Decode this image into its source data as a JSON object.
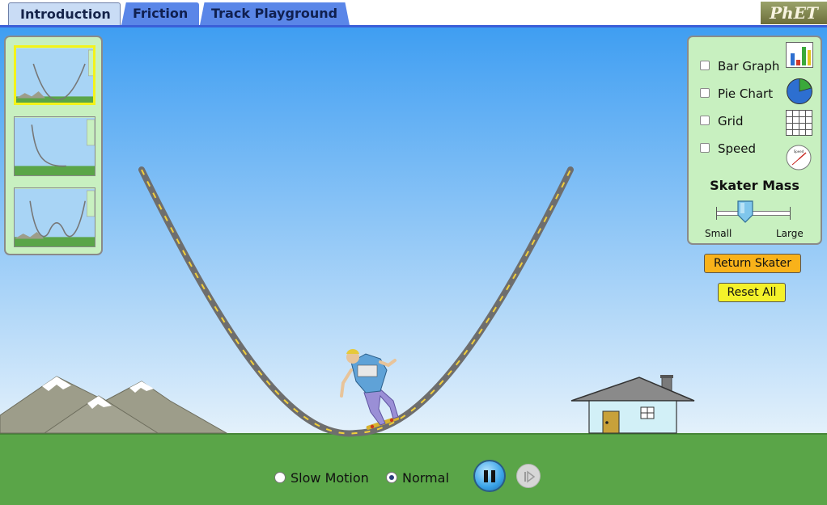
{
  "tabs": [
    {
      "label": "Introduction",
      "active": true
    },
    {
      "label": "Friction",
      "active": false
    },
    {
      "label": "Track Playground",
      "active": false
    }
  ],
  "logo": {
    "text": "PhET"
  },
  "thumbnails": [
    {
      "name": "parabola-track",
      "selected": true
    },
    {
      "name": "ramp-track",
      "selected": false
    },
    {
      "name": "double-well-track",
      "selected": false
    }
  ],
  "controls": {
    "options": [
      {
        "label": "Bar Graph",
        "checked": false,
        "icon": "bar-graph-icon"
      },
      {
        "label": "Pie Chart",
        "checked": false,
        "icon": "pie-chart-icon"
      },
      {
        "label": "Grid",
        "checked": false,
        "icon": "grid-icon"
      },
      {
        "label": "Speed",
        "checked": false,
        "icon": "speedometer-icon"
      }
    ],
    "mass": {
      "title": "Skater Mass",
      "min_label": "Small",
      "max_label": "Large",
      "value": 0.38
    },
    "speedometer_label": "Speed"
  },
  "buttons": {
    "return_skater": "Return Skater",
    "reset_all": "Reset All"
  },
  "playback": {
    "slow_motion": "Slow Motion",
    "normal": "Normal",
    "selected": "normal"
  },
  "colors": {
    "sky_top": "#3f9ef2",
    "sky_bottom": "#e4f1fb",
    "ground": "#5aa548",
    "panel": "#c8f0c0",
    "track": "#6e6e6e",
    "track_dash": "#f1cf3b",
    "tab_active": "#c9dcf5",
    "tab_inactive": "#5a86e8",
    "return_button": "#f9b21a",
    "reset_button": "#f4f12a"
  }
}
